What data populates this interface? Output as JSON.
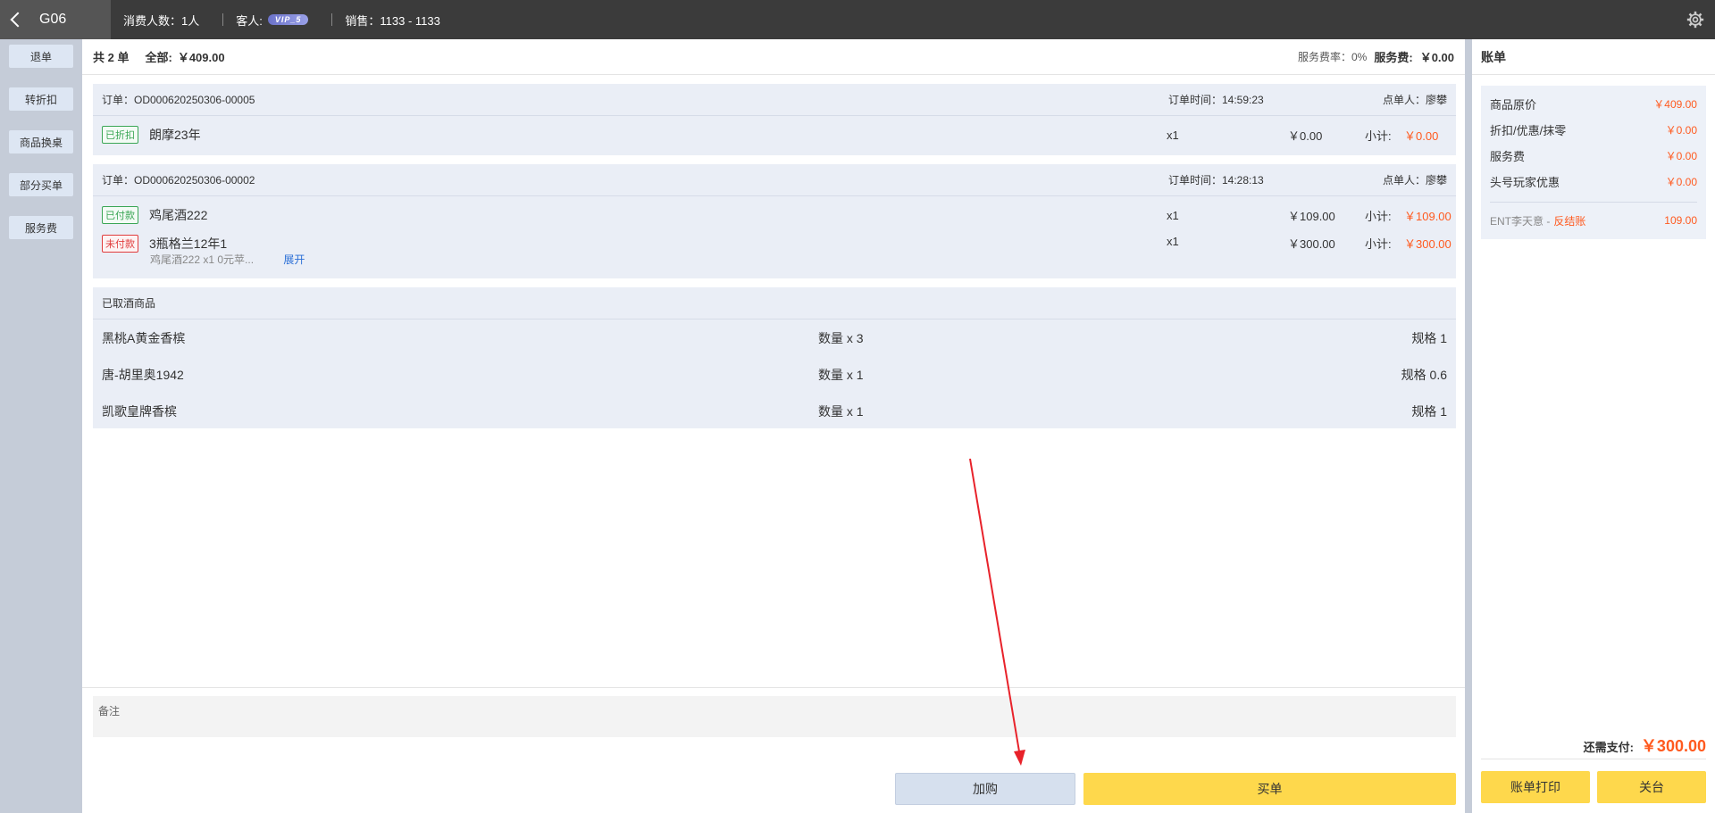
{
  "topbar": {
    "table_name": "G06",
    "guests": "消费人数：1人",
    "customer_label": "客人:",
    "vip_level": "VIP_5",
    "sales": "销售：1133 - 1133"
  },
  "sidebar": {
    "items": [
      "退单",
      "转折扣",
      "商品换桌",
      "部分买单",
      "服务费"
    ]
  },
  "summary": {
    "order_count": "共 2 单",
    "total_label": "全部:",
    "total": "￥409.00",
    "service_rate": "服务费率：0%",
    "service_fee_label": "服务费:",
    "service_fee": "￥0.00"
  },
  "orders": [
    {
      "id": "订单：OD000620250306-00005",
      "time": "订单时间：14:59:23",
      "by": "点单人：廖攀",
      "items": [
        {
          "tag": "已折扣",
          "name": "朗摩23年",
          "qty": "x1",
          "price": "￥0.00",
          "subtotal_label": "小计:",
          "subtotal": "￥0.00"
        }
      ]
    },
    {
      "id": "订单：OD000620250306-00002",
      "time": "订单时间：14:28:13",
      "by": "点单人：廖攀",
      "items": [
        {
          "tag": "已付款",
          "name": "鸡尾酒222",
          "qty": "x1",
          "price": "￥109.00",
          "subtotal_label": "小计:",
          "subtotal": "￥109.00"
        },
        {
          "tag": "未付款",
          "name": "3瓶格兰12年1",
          "qty": "x1",
          "price": "￥300.00",
          "subtotal_label": "小计:",
          "subtotal": "￥300.00",
          "detail": "鸡尾酒222 x1   0元苹...",
          "expand": "展开"
        }
      ]
    }
  ],
  "taken": {
    "title": "已取酒商品",
    "rows": [
      {
        "name": "黑桃A黄金香槟",
        "qty": "数量 x 3",
        "spec": "规格 1"
      },
      {
        "name": "唐-胡里奥1942",
        "qty": "数量 x 1",
        "spec": "规格 0.6"
      },
      {
        "name": "凯歌皇牌香槟",
        "qty": "数量 x 1",
        "spec": "规格 1"
      }
    ]
  },
  "remarks": {
    "label": "备注"
  },
  "actions": {
    "add": "加购",
    "buy": "买单"
  },
  "bill": {
    "title": "账单",
    "rows": [
      {
        "label": "商品原价",
        "value": "￥409.00"
      },
      {
        "label": "折扣/优惠/抹零",
        "value": "￥0.00"
      },
      {
        "label": "服务费",
        "value": "￥0.00"
      },
      {
        "label": "头号玩家优惠",
        "value": "￥0.00"
      }
    ],
    "note_name": "ENT李天意 -",
    "note_highlight": "反结账",
    "note_value": "109.00",
    "due_label": "还需支付:",
    "due_value": "￥300.00",
    "print": "账单打印",
    "close": "关台"
  },
  "colors": {
    "accent_orange": "#ff5a1f",
    "button_yellow": "#fed84c",
    "annotation_red": "#e8222a"
  }
}
